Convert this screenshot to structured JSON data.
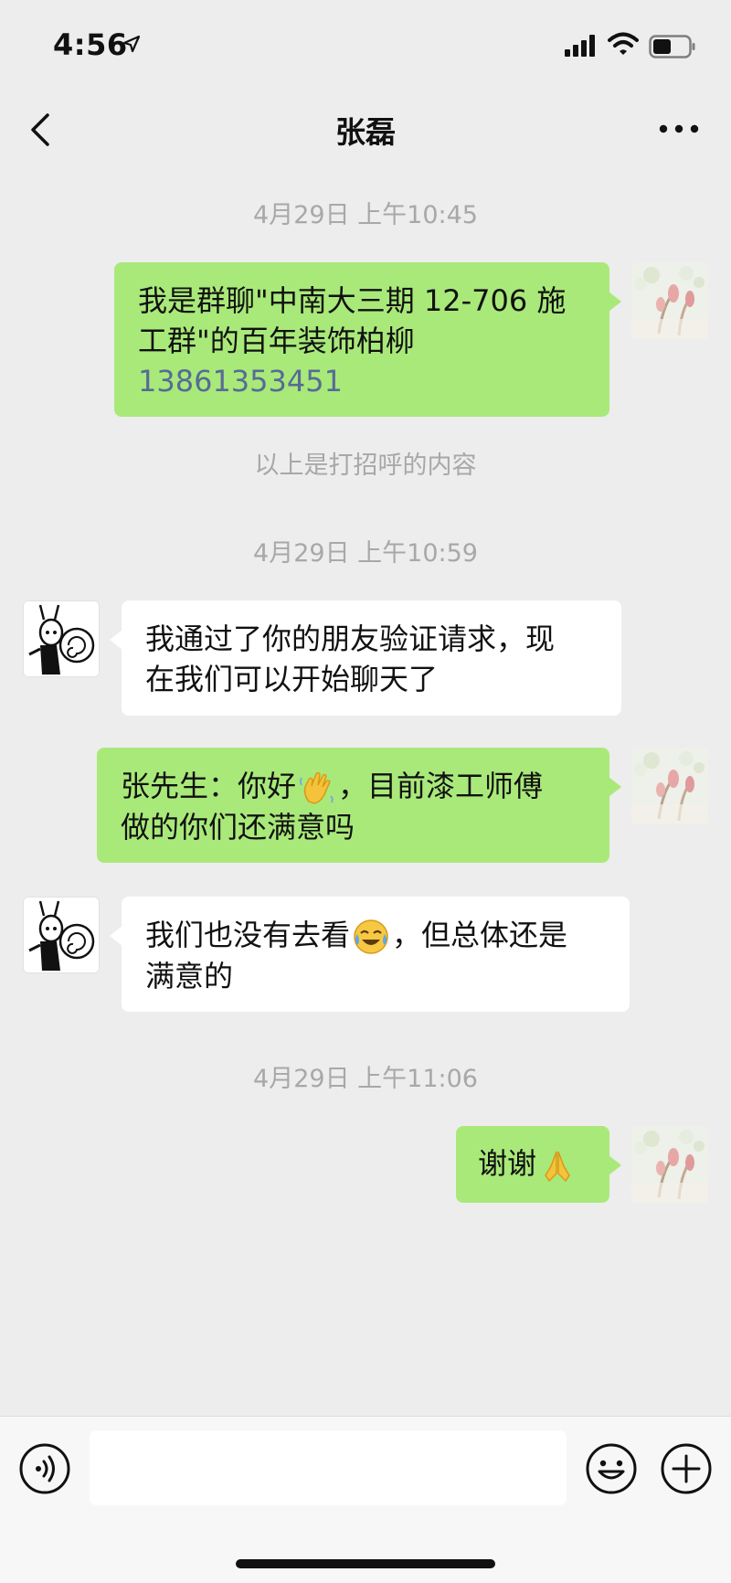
{
  "status_bar": {
    "time": "4:56",
    "icons": [
      "location-arrow-icon",
      "signal-icon",
      "wifi-icon",
      "battery-icon"
    ]
  },
  "header": {
    "title": "张磊",
    "back_icon": "chevron-left-icon",
    "more_icon": "more-dots-icon"
  },
  "chat": {
    "timestamps": [
      "4月29日 上午10:45",
      "4月29日 上午10:59",
      "4月29日 上午11:06"
    ],
    "system_note": "以上是打招呼的内容",
    "messages": [
      {
        "sender": "me",
        "lines": [
          "我是群聊\"中南大三期 12-706 施",
          "工群\"的百年装饰柏柳"
        ],
        "link": "13861353451"
      },
      {
        "sender": "contact",
        "lines": [
          "我通过了你的朋友验证请求，现",
          "在我们可以开始聊天了"
        ]
      },
      {
        "sender": "me",
        "line1_before": "张先生：你好",
        "line1_after": "，目前漆工师傅",
        "line2": "做的你们还满意吗",
        "emoji": "waving-hand"
      },
      {
        "sender": "contact",
        "line1_before": "我们也没有去看",
        "line1_after": "，但总体还是",
        "line2": "满意的",
        "emoji": "laughing-crying-face"
      },
      {
        "sender": "me",
        "text": "谢谢",
        "emoji": "folded-hands"
      }
    ]
  },
  "input_bar": {
    "voice_icon": "voice-icon",
    "input_value": "",
    "emoji_icon": "emoji-icon",
    "plus_icon": "plus-icon"
  },
  "colors": {
    "background": "#ededed",
    "sent_bubble": "#a9e97a",
    "received_bubble": "#ffffff",
    "link": "#576b95",
    "timestamp": "#a8a8a8"
  }
}
